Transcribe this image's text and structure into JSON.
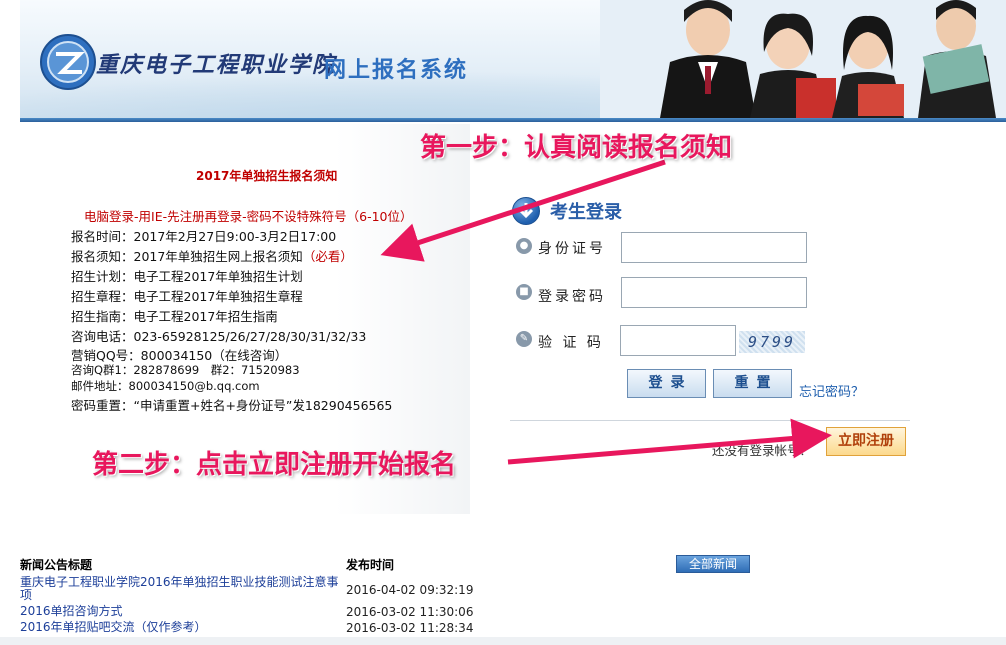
{
  "header": {
    "school_name": "重庆电子工程职业学院",
    "system_name": "网上报名系统"
  },
  "notice": {
    "title": "2017年单独招生报名须知",
    "warning": "电脑登录-用IE-先注册再登录-密码不设特殊符号（6-10位）",
    "lines": [
      "报名时间：2017年2月27日9:00-3月2日17:00",
      "报名须知：2017年单独招生网上报名须知",
      "招生计划：电子工程2017年单独招生计划",
      "招生章程：电子工程2017年单独招生章程",
      "招生指南：电子工程2017年招生指南",
      "咨询电话：023-65928125/26/27/28/30/31/32/33",
      "营销QQ号：800034150（在线咨询）",
      "咨询Q群1：282878699　群2：71520983",
      "邮件地址：800034150@b.qq.com",
      "密码重置：“申请重置+姓名+身份证号”发18290456565"
    ],
    "must_read": "（必看）"
  },
  "login": {
    "title": "考生登录",
    "id_label": "身份证号",
    "password_label": "登录密码",
    "captcha_label": "验 证 码",
    "captcha_text": "9799",
    "login_button": "登录",
    "reset_button": "重置",
    "forgot_link": "忘记密码？",
    "no_account_text": "还没有登录帐号？",
    "register_button": "立即注册"
  },
  "annotations": {
    "step1": "第一步：认真阅读报名须知",
    "step2": "第二步：点击立即注册开始报名",
    "color": "#e8175d"
  },
  "news": {
    "title_header": "新闻公告标题",
    "time_header": "发布时间",
    "all_news_button": "全部新闻",
    "items": [
      {
        "title": "重庆电子工程职业学院2016年单独招生职业技能测试注意事项",
        "time": "2016-04-02 09:32:19"
      },
      {
        "title": "2016单招咨询方式",
        "time": "2016-03-02 11:30:06"
      },
      {
        "title": "2016年单招贴吧交流（仅作参考）",
        "time": "2016-03-02 11:28:34"
      }
    ]
  }
}
